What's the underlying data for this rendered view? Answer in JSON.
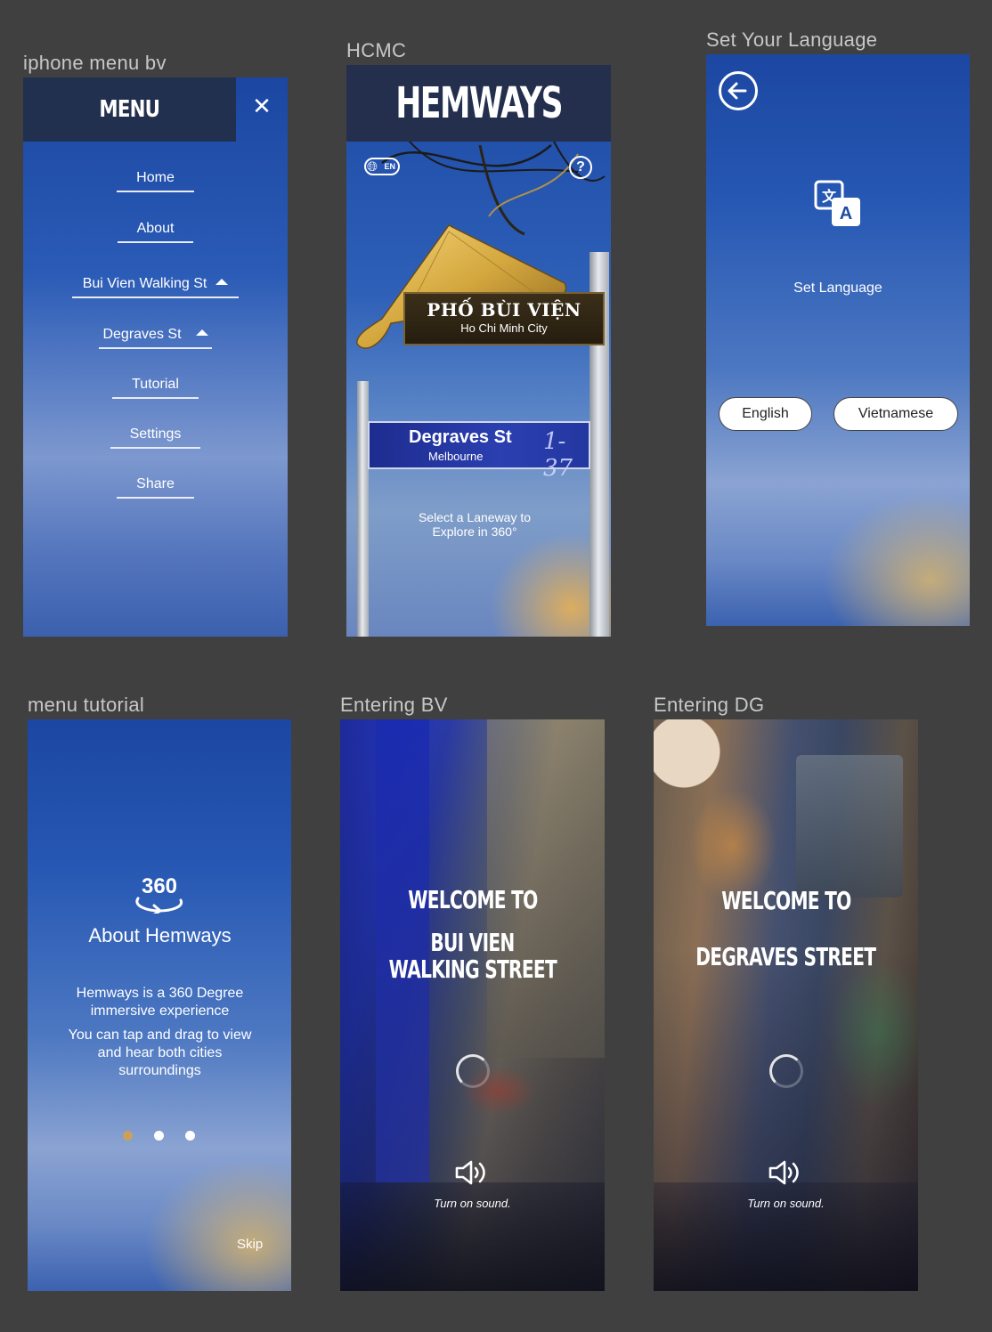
{
  "frames": {
    "menu": {
      "title": "iphone menu bv"
    },
    "hcmc": {
      "title": "HCMC"
    },
    "lang": {
      "title": "Set Your Language"
    },
    "tutorial": {
      "title": "menu tutorial"
    },
    "enter_bv": {
      "title": "Entering BV"
    },
    "enter_dg": {
      "title": "Entering DG"
    }
  },
  "menu": {
    "header": "MENU",
    "close_icon": "close-icon",
    "items": [
      {
        "label": "Home"
      },
      {
        "label": "About"
      },
      {
        "label": "Bui Vien Walking St",
        "expandable": true
      },
      {
        "label": "Degraves St",
        "expandable": true
      },
      {
        "label": "Tutorial"
      },
      {
        "label": "Settings"
      },
      {
        "label": "Share"
      }
    ]
  },
  "hcmc": {
    "brand": "HEMWAYS",
    "lang_badge": "EN",
    "sign_vn": {
      "name": "PHỐ BÙI VIỆN",
      "city": "Ho Chi Minh City"
    },
    "sign_au": {
      "name": "Degraves St",
      "city": "Melbourne",
      "number": "1-37"
    },
    "prompt": [
      "Select a Laneway to",
      "Explore in 360°"
    ]
  },
  "lang": {
    "heading": "Set Language",
    "options": [
      "English",
      "Vietnamese"
    ]
  },
  "tutorial": {
    "badge": "360",
    "heading": "About Hemways",
    "body1": [
      "Hemways is a 360 Degree",
      "immersive experience"
    ],
    "body2": [
      "You can tap and drag to view",
      "and hear both cities",
      "surroundings"
    ],
    "skip": "Skip",
    "active_dot": 0,
    "dot_count": 3
  },
  "enter_bv": {
    "line1": "WELCOME TO",
    "line2": "BUI VIEN",
    "line3": "WALKING STREET",
    "sound": "Turn on sound."
  },
  "enter_dg": {
    "line1": "WELCOME TO",
    "line2": "DEGRAVES STREET",
    "sound": "Turn on sound."
  },
  "colors": {
    "canvas": "#404040",
    "header_navy": "#22304f",
    "accent_gold": "#c9a15c",
    "sign_blue": "#2a3db0"
  }
}
